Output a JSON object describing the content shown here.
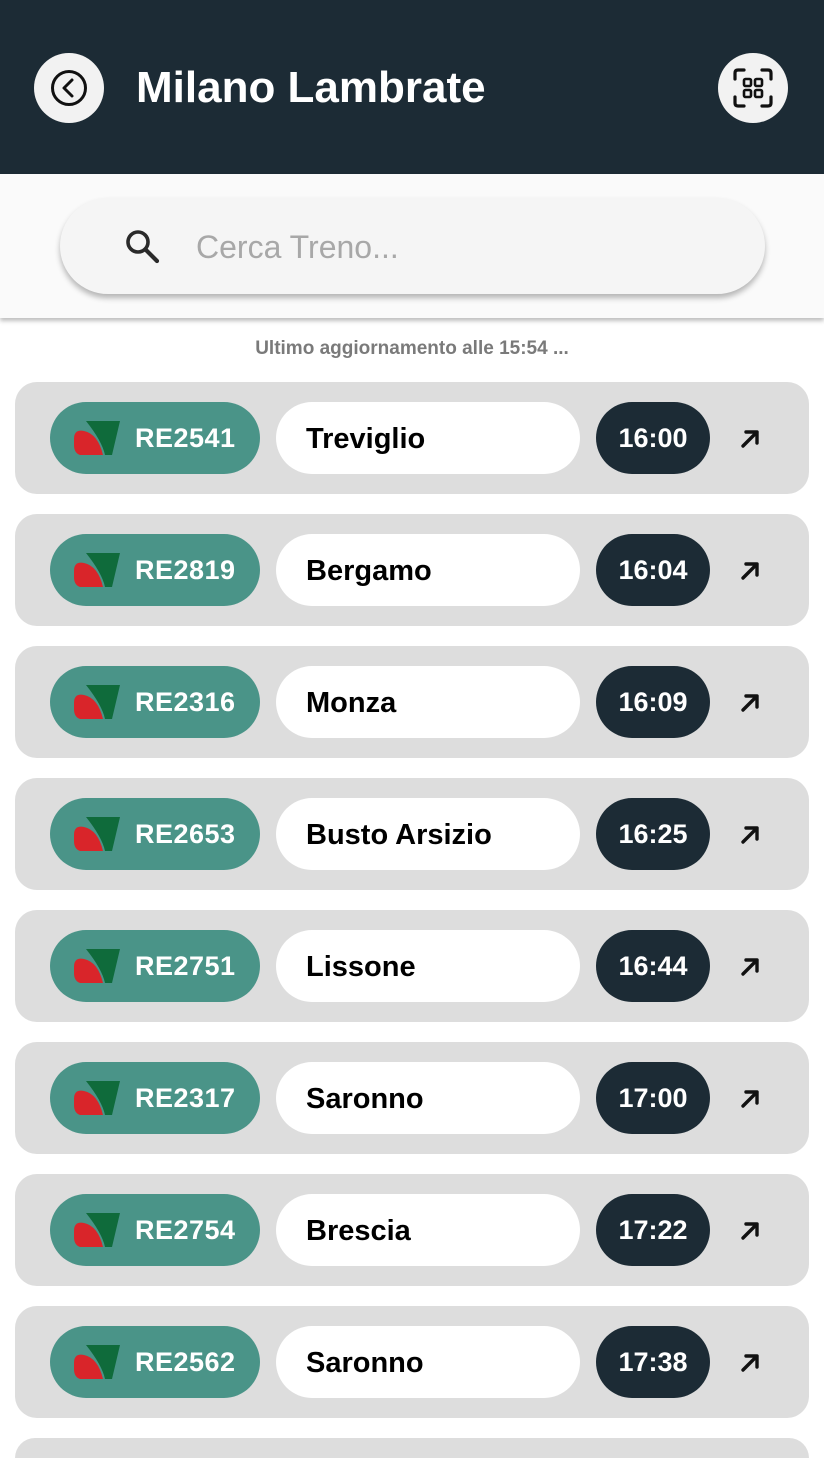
{
  "header": {
    "title": "Milano Lambrate",
    "back_icon": "back-circle-icon",
    "scan_icon": "qr-scan-icon",
    "background": "#1c2b35"
  },
  "search": {
    "placeholder": "Cerca Treno...",
    "value": ""
  },
  "status": {
    "last_update": "Ultimo aggiornamento alle 15:54 ..."
  },
  "colors": {
    "badge": "#4a9488",
    "time_pill": "#1c2b35",
    "row_bg": "#dddddd",
    "logo_green": "#0f6b3b",
    "logo_red": "#d9252a"
  },
  "trains": [
    {
      "number": "RE2541",
      "destination": "Treviglio",
      "time": "16:00"
    },
    {
      "number": "RE2819",
      "destination": "Bergamo",
      "time": "16:04"
    },
    {
      "number": "RE2316",
      "destination": "Monza",
      "time": "16:09"
    },
    {
      "number": "RE2653",
      "destination": "Busto Arsizio",
      "time": "16:25"
    },
    {
      "number": "RE2751",
      "destination": "Lissone",
      "time": "16:44"
    },
    {
      "number": "RE2317",
      "destination": "Saronno",
      "time": "17:00"
    },
    {
      "number": "RE2754",
      "destination": "Brescia",
      "time": "17:22"
    },
    {
      "number": "RE2562",
      "destination": "Saronno",
      "time": "17:38"
    }
  ]
}
